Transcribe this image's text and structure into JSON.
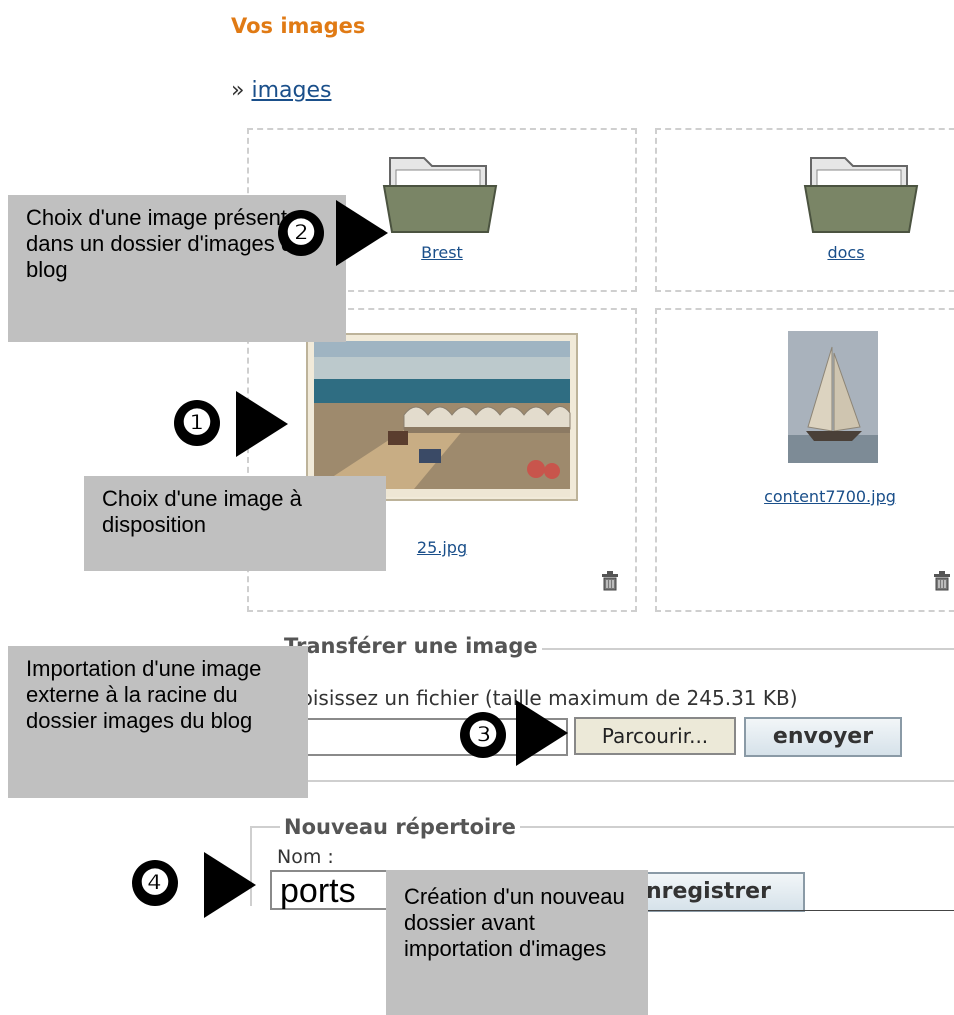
{
  "page_title": "Vos images",
  "breadcrumb": {
    "prefix": "»",
    "link": "images"
  },
  "folders": [
    {
      "name": "Brest"
    },
    {
      "name": "docs"
    }
  ],
  "images": [
    {
      "name": "25.jpg"
    },
    {
      "name": "content7700.jpg"
    }
  ],
  "upload": {
    "legend": "Transférer une image",
    "label": "Choisissez un fichier (taille maximum de 245.31 KB)",
    "browse_label": "Parcourir...",
    "send_label": "envoyer"
  },
  "new_folder": {
    "legend": "Nouveau répertoire",
    "name_label": "Nom :",
    "name_value": "ports",
    "save_label": "enregistrer"
  },
  "annotations": {
    "one": {
      "number": "❶",
      "text": "Choix d'une image à disposition"
    },
    "two": {
      "number": "❷",
      "text": "Choix d'une image présente dans un dossier d'images du blog"
    },
    "three": {
      "number": "❸",
      "text": "Importation d'une image externe à la racine du dossier images du blog"
    },
    "four": {
      "number": "❹",
      "text": "Création d'un nouveau dossier avant importation d'images"
    }
  },
  "icons": {
    "folder": "folder-icon",
    "trash": "trash-icon"
  }
}
